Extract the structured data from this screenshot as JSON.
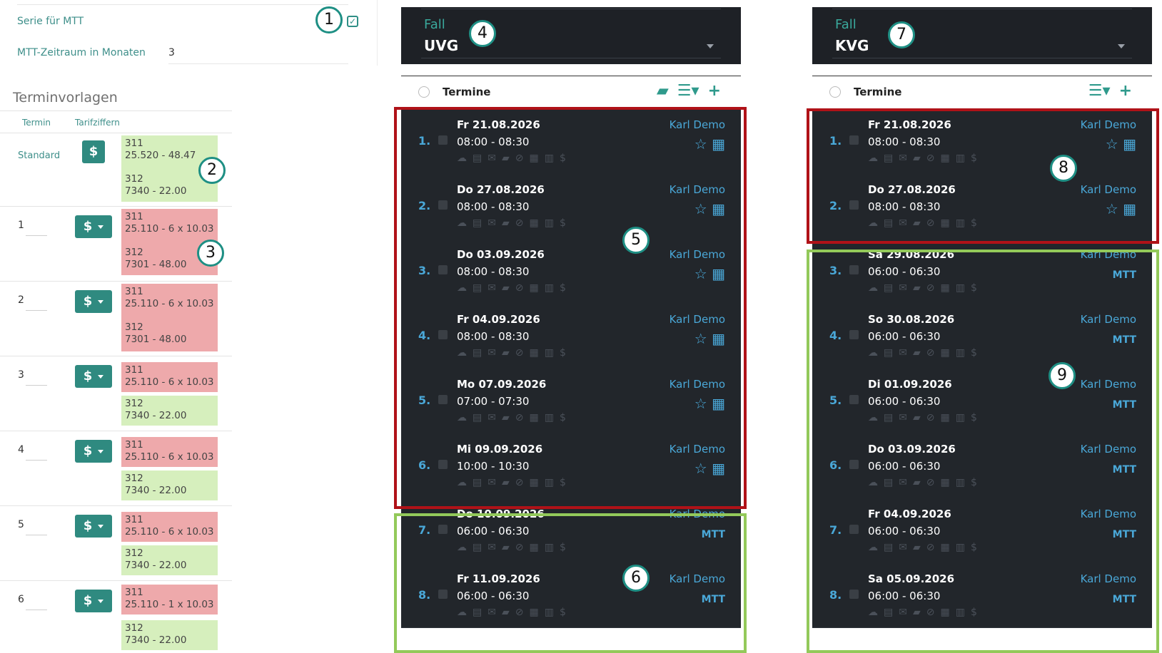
{
  "settings": {
    "serie_label": "Serie für MTT",
    "serie_checked": true,
    "zeitraum_label": "MTT-Zeitraum in Monaten",
    "zeitraum_value": "3"
  },
  "terminvorlagen": {
    "title": "Terminvorlagen",
    "col_termin": "Termin",
    "col_tarif": "Tarifziffern",
    "rows": [
      {
        "termin": "Standard",
        "blocks": [
          {
            "color": "green",
            "l1": "311",
            "l2": "25.520 - 48.47",
            "l3": "312",
            "l4": "7340 - 22.00"
          }
        ]
      },
      {
        "termin": "1",
        "blocks": [
          {
            "color": "red",
            "l1": "311",
            "l2": "25.110 - 6 x 10.03",
            "l3": "312",
            "l4": "7301 - 48.00"
          }
        ]
      },
      {
        "termin": "2",
        "blocks": [
          {
            "color": "red",
            "l1": "311",
            "l2": "25.110 - 6 x 10.03",
            "l3": "312",
            "l4": "7301 - 48.00"
          }
        ]
      },
      {
        "termin": "3",
        "blocks": [
          {
            "color": "red",
            "l1": "311",
            "l2": "25.110 - 6 x 10.03"
          },
          {
            "color": "green",
            "l1": "312",
            "l2": "7340 - 22.00"
          }
        ]
      },
      {
        "termin": "4",
        "blocks": [
          {
            "color": "red",
            "l1": "311",
            "l2": "25.110 - 6 x 10.03"
          },
          {
            "color": "green",
            "l1": "312",
            "l2": "7340 - 22.00"
          }
        ]
      },
      {
        "termin": "5",
        "blocks": [
          {
            "color": "red",
            "l1": "311",
            "l2": "25.110 - 6 x 10.03"
          },
          {
            "color": "green",
            "l1": "312",
            "l2": "7340 - 22.00"
          }
        ]
      },
      {
        "termin": "6",
        "blocks": [
          {
            "color": "red",
            "l1": "311",
            "l2": "25.110 - 1 x 10.03"
          },
          {
            "color": "green",
            "l1": "312",
            "l2": "7340 - 22.00"
          }
        ]
      }
    ],
    "dollar": "$"
  },
  "uvg": {
    "fall_label": "Fall",
    "fall_value": "UVG",
    "termine_title": "Termine",
    "appointments": [
      {
        "nr": "1.",
        "date": "Fr 21.08.2026",
        "time": "08:00 - 08:30",
        "doctor": "Karl Demo",
        "tag": ""
      },
      {
        "nr": "2.",
        "date": "Do 27.08.2026",
        "time": "08:00 - 08:30",
        "doctor": "Karl Demo",
        "tag": ""
      },
      {
        "nr": "3.",
        "date": "Do 03.09.2026",
        "time": "08:00 - 08:30",
        "doctor": "Karl Demo",
        "tag": ""
      },
      {
        "nr": "4.",
        "date": "Fr 04.09.2026",
        "time": "08:00 - 08:30",
        "doctor": "Karl Demo",
        "tag": ""
      },
      {
        "nr": "5.",
        "date": "Mo 07.09.2026",
        "time": "07:00 - 07:30",
        "doctor": "Karl Demo",
        "tag": ""
      },
      {
        "nr": "6.",
        "date": "Mi 09.09.2026",
        "time": "10:00 - 10:30",
        "doctor": "Karl Demo",
        "tag": ""
      },
      {
        "nr": "7.",
        "date": "Do 10.09.2026",
        "time": "06:00 - 06:30",
        "doctor": "Karl Demo",
        "tag": "MTT"
      },
      {
        "nr": "8.",
        "date": "Fr 11.09.2026",
        "time": "06:00 - 06:30",
        "doctor": "Karl Demo",
        "tag": "MTT"
      }
    ]
  },
  "kvg": {
    "fall_label": "Fall",
    "fall_value": "KVG",
    "termine_title": "Termine",
    "appointments": [
      {
        "nr": "1.",
        "date": "Fr 21.08.2026",
        "time": "08:00 - 08:30",
        "doctor": "Karl Demo",
        "tag": ""
      },
      {
        "nr": "2.",
        "date": "Do 27.08.2026",
        "time": "08:00 - 08:30",
        "doctor": "Karl Demo",
        "tag": ""
      },
      {
        "nr": "3.",
        "date": "Sa 29.08.2026",
        "time": "06:00 - 06:30",
        "doctor": "Karl Demo",
        "tag": "MTT"
      },
      {
        "nr": "4.",
        "date": "So 30.08.2026",
        "time": "06:00 - 06:30",
        "doctor": "Karl Demo",
        "tag": "MTT"
      },
      {
        "nr": "5.",
        "date": "Di 01.09.2026",
        "time": "06:00 - 06:30",
        "doctor": "Karl Demo",
        "tag": "MTT"
      },
      {
        "nr": "6.",
        "date": "Do 03.09.2026",
        "time": "06:00 - 06:30",
        "doctor": "Karl Demo",
        "tag": "MTT"
      },
      {
        "nr": "7.",
        "date": "Fr 04.09.2026",
        "time": "06:00 - 06:30",
        "doctor": "Karl Demo",
        "tag": "MTT"
      },
      {
        "nr": "8.",
        "date": "Sa 05.09.2026",
        "time": "06:00 - 06:30",
        "doctor": "Karl Demo",
        "tag": "MTT"
      }
    ]
  },
  "annotations": [
    "1",
    "2",
    "3",
    "4",
    "5",
    "6",
    "7",
    "8",
    "9"
  ],
  "icons": {
    "appointment_row": [
      "cloud-icon",
      "printer-icon",
      "mail-icon",
      "chat-icon",
      "cancel-icon",
      "calendar-day-icon",
      "calculator-icon",
      "dollar-icon"
    ],
    "star": "star-icon",
    "calendar": "calendar-icon"
  },
  "colors": {
    "accent": "#2f8a80",
    "dark_bg": "#22262b",
    "blue_text": "#4aa8d8",
    "tarif_green": "#d6efbd",
    "tarif_red": "#eea9ab",
    "frame_red": "#b01218",
    "frame_green": "#93c95a"
  }
}
